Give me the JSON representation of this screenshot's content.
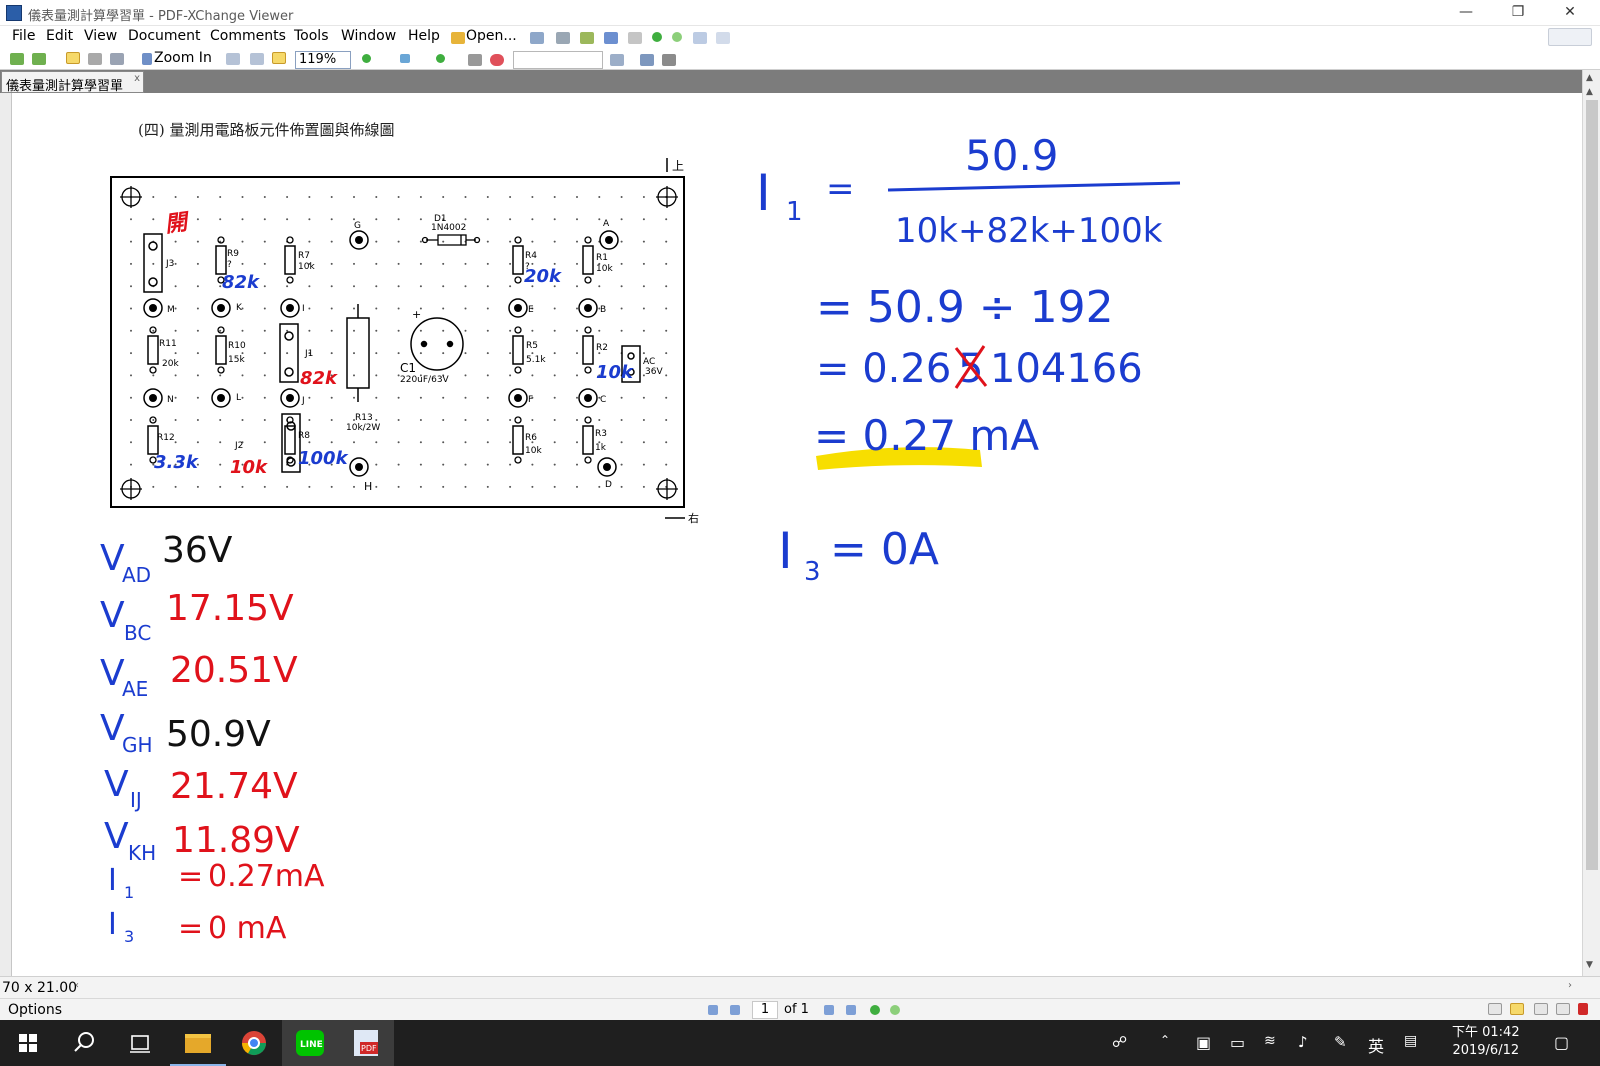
{
  "window": {
    "title": "儀表量測計算學習單 - PDF-XChange Viewer",
    "minimize": "—",
    "restore": "❐",
    "close": "✕"
  },
  "menu": [
    "File",
    "Edit",
    "View",
    "Document",
    "Comments",
    "Tools",
    "Window",
    "Help"
  ],
  "toolbar": {
    "open_label": "Open...",
    "zoom_in_label": "Zoom In",
    "zoom_value": "119%"
  },
  "tab": {
    "label": "儀表量測計算學習單",
    "close": "x"
  },
  "document": {
    "heading": "(四) 量測用電路板元件佈置圖與佈線圖",
    "board": {
      "top_mark": "上",
      "right_mark": "右",
      "labels": {
        "j3": "J3",
        "r9": "R9",
        "r9_val": "?",
        "r7": "R7",
        "r7_val": "10k",
        "g": "G",
        "d1": "D1",
        "d1_part": "1N4002",
        "r4": "R4",
        "r4_val": "?",
        "a": "A",
        "r1": "R1",
        "r1_val": "10k",
        "m": "M",
        "k": "K",
        "i": "I",
        "e": "E",
        "b": "B",
        "r11": "R11",
        "r11_val": "20k",
        "r10": "R10",
        "r10_val": "15k",
        "j1": "J1",
        "c1": "C1",
        "c1_val": "220uF/63V",
        "plus": "+",
        "r5": "R5",
        "r5_val": "5.1k",
        "r2": "R2",
        "ac": "AC",
        "ac_val": "36V",
        "n": "N",
        "l": "L",
        "j": "J",
        "r13": "R13",
        "r13_val": "10k/2W",
        "f": "F",
        "c": "C",
        "r12": "R12",
        "j2": "J2",
        "r8": "R8",
        "r6": "R6",
        "r6_val": "10k",
        "r3": "R3",
        "r3_val": "1k",
        "h": "H",
        "d": "D"
      },
      "annotations": {
        "kai": "開",
        "r9": "82k",
        "r4": "20k",
        "j1": "82k",
        "r2": "10k",
        "r12": "3.3k",
        "j2": "10k",
        "r8": "100k"
      }
    },
    "measurements": [
      {
        "sub": "AD",
        "value": "36V",
        "color": "#111111"
      },
      {
        "sub": "BC",
        "value": "17.15V",
        "color": "#e0121b"
      },
      {
        "sub": "AE",
        "value": "20.51V",
        "color": "#e0121b"
      },
      {
        "sub": "GH",
        "value": "50.9V",
        "color": "#111111"
      },
      {
        "sub": "IJ",
        "value": "21.74V",
        "color": "#e0121b"
      },
      {
        "sub": "KH",
        "value": "11.89V",
        "color": "#e0121b"
      }
    ],
    "currents": [
      {
        "name": "I",
        "sub": "1",
        "value": "0.27mA"
      },
      {
        "name": "I",
        "sub": "3",
        "value": "0 mA"
      }
    ],
    "calculation": {
      "lhs": "I",
      "lhs_sub": "1",
      "eq": "=",
      "numerator": "50.9",
      "denominator": "10k+82k+100k",
      "step1": "= 50.9 ÷ 192",
      "step2_prefix": "= 0.26",
      "step2_struck": "5",
      "step2_rest": "104166",
      "step3": "= 0.27 mA",
      "i3_lhs": "I",
      "i3_sub": "3",
      "i3_value": "= 0A"
    }
  },
  "scrollbar": {
    "page_size": "70 x 21.00"
  },
  "status": {
    "options": "Options",
    "page_current": "1",
    "page_total": "of 1"
  },
  "taskbar": {
    "clock_time": "下午 01:42",
    "clock_date": "2019/6/12",
    "ime": "英"
  },
  "colors": {
    "ink_blue": "#1b3ccf",
    "ink_red": "#e0121b",
    "highlight": "#f7de00",
    "taskbar": "#1f1f1f"
  }
}
